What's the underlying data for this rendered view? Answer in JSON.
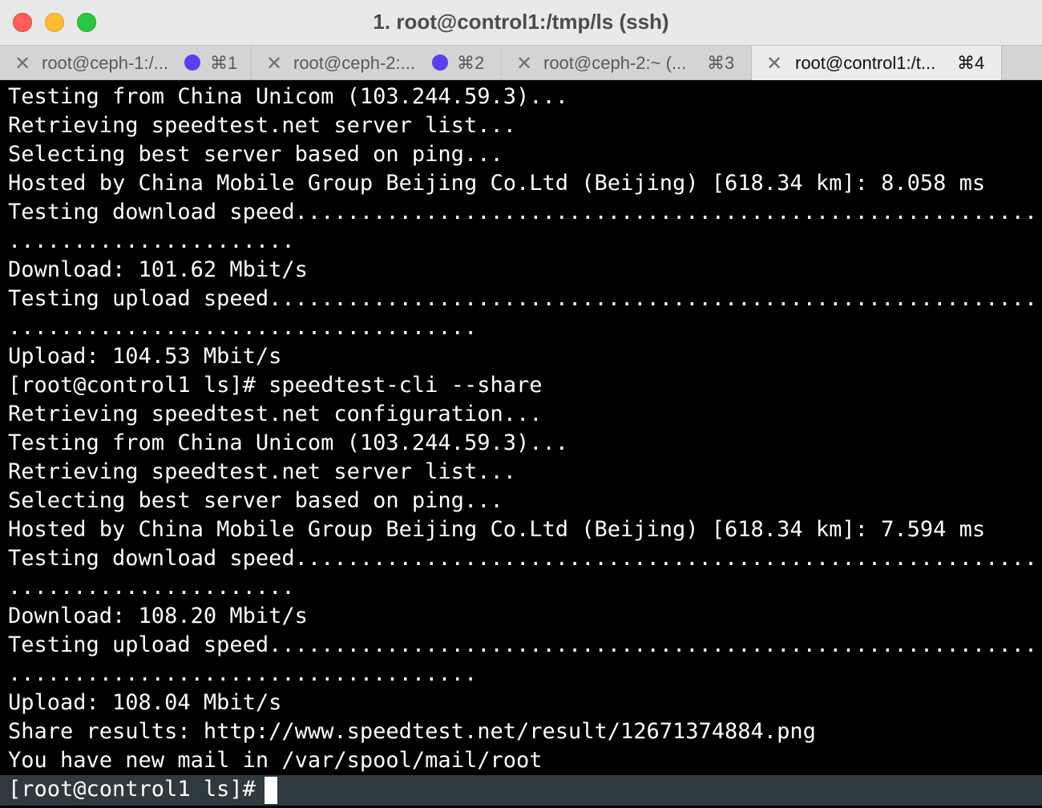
{
  "window": {
    "title": "1. root@control1:/tmp/ls (ssh)"
  },
  "tabs": [
    {
      "label": "root@ceph-1:/...",
      "shortcut": "⌘1",
      "active": false,
      "activity_dot": true
    },
    {
      "label": "root@ceph-2:...",
      "shortcut": "⌘2",
      "active": false,
      "activity_dot": true
    },
    {
      "label": "root@ceph-2:~ (...",
      "shortcut": "⌘3",
      "active": false,
      "activity_dot": false
    },
    {
      "label": "root@control1:/t...",
      "shortcut": "⌘4",
      "active": true,
      "activity_dot": false
    }
  ],
  "terminal": {
    "lines": [
      "Testing from China Unicom (103.244.59.3)...",
      "Retrieving speedtest.net server list...",
      "Selecting best server based on ping...",
      "Hosted by China Mobile Group Beijing Co.Ltd (Beijing) [618.34 km]: 8.058 ms",
      "Testing download speed................................................................................",
      "......................",
      "Download: 101.62 Mbit/s",
      "Testing upload speed..................................................................................",
      "....................................",
      "Upload: 104.53 Mbit/s",
      "[root@control1 ls]# speedtest-cli --share",
      "Retrieving speedtest.net configuration...",
      "Testing from China Unicom (103.244.59.3)...",
      "Retrieving speedtest.net server list...",
      "Selecting best server based on ping...",
      "Hosted by China Mobile Group Beijing Co.Ltd (Beijing) [618.34 km]: 7.594 ms",
      "Testing download speed................................................................................",
      "......................",
      "Download: 108.20 Mbit/s",
      "Testing upload speed..................................................................................",
      "....................................",
      "Upload: 108.04 Mbit/s",
      "Share results: http://www.speedtest.net/result/12671374884.png",
      "You have new mail in /var/spool/mail/root"
    ],
    "prompt": "[root@control1 ls]#"
  },
  "colors": {
    "background": "#000000",
    "foreground": "#ffffff",
    "activity_dot": "#5a3ef0",
    "prompt_bar": "#2f3a3f"
  }
}
